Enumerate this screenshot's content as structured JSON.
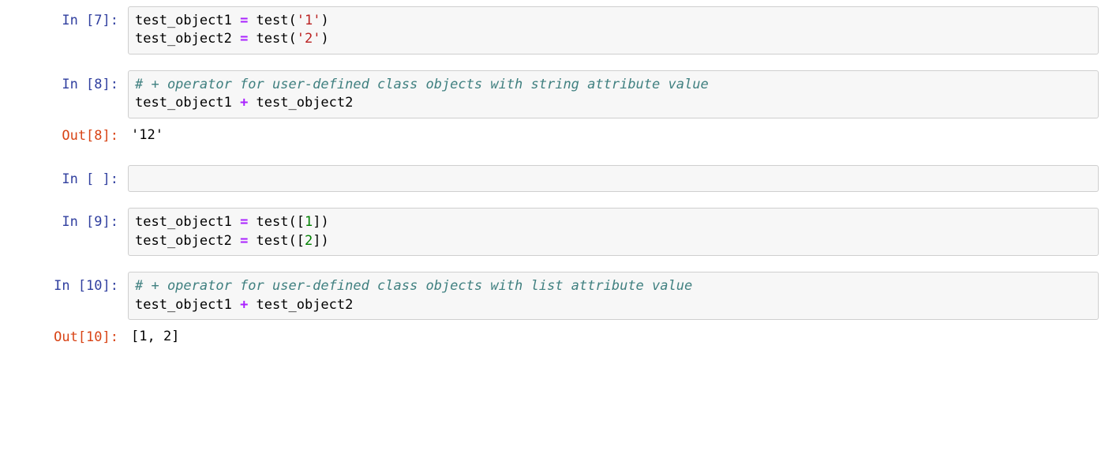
{
  "prompts": {
    "in7": "In [7]:",
    "in8": "In [8]:",
    "out8": "Out[8]:",
    "inEmpty": "In [ ]:",
    "in9": "In [9]:",
    "in10": "In [10]:",
    "out10": "Out[10]:"
  },
  "code": {
    "cell7": {
      "l1_name1": "test_object1",
      "l1_assign": " = ",
      "l1_func": "test",
      "l1_paren_open": "(",
      "l1_str": "'1'",
      "l1_paren_close": ")",
      "l2_name1": "test_object2",
      "l2_assign": " = ",
      "l2_func": "test",
      "l2_paren_open": "(",
      "l2_str": "'2'",
      "l2_paren_close": ")"
    },
    "cell8": {
      "l1_comment": "# + operator for user-defined class objects with string attribute value",
      "l2_name1": "test_object1",
      "l2_op": " + ",
      "l2_name2": "test_object2"
    },
    "out8": {
      "text": "'12'"
    },
    "cellEmpty": {
      "text": ""
    },
    "cell9": {
      "l1_name1": "test_object1",
      "l1_assign": " = ",
      "l1_func": "test",
      "l1_paren_open": "([",
      "l1_num": "1",
      "l1_paren_close": "])",
      "l2_name1": "test_object2",
      "l2_assign": " = ",
      "l2_func": "test",
      "l2_paren_open": "([",
      "l2_num": "2",
      "l2_paren_close": "])"
    },
    "cell10": {
      "l1_comment": "# + operator for user-defined class objects with list attribute value",
      "l2_name1": "test_object1",
      "l2_op": " + ",
      "l2_name2": "test_object2"
    },
    "out10": {
      "text": "[1, 2]"
    }
  }
}
